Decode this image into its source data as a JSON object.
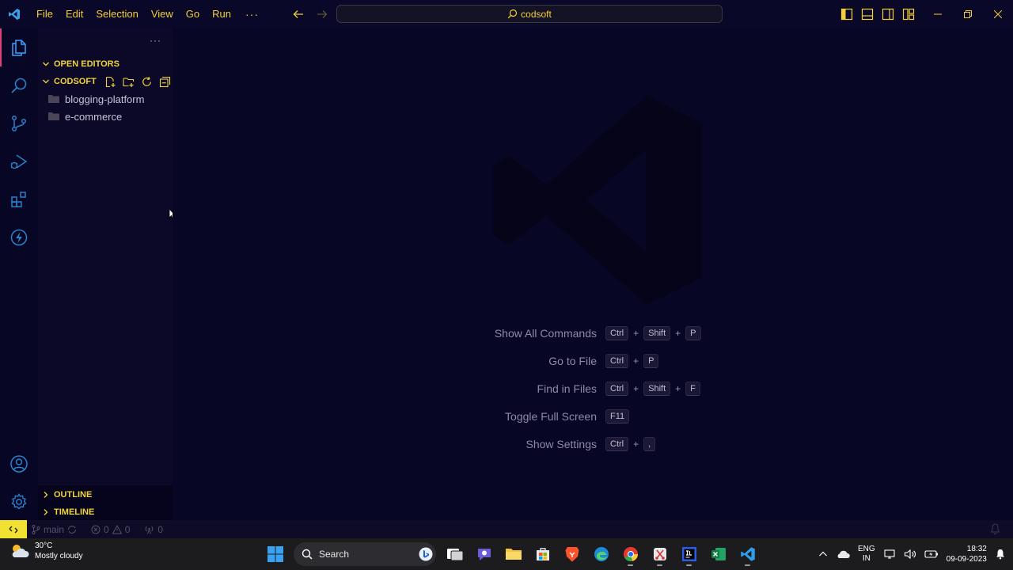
{
  "window": {
    "menu": [
      "File",
      "Edit",
      "Selection",
      "View",
      "Go",
      "Run"
    ],
    "menu_more": "···",
    "command_center_text": "codsoft"
  },
  "sidebar": {
    "more": "···",
    "open_editors_label": "OPEN EDITORS",
    "folder_label": "CODSOFT",
    "items": [
      {
        "label": "blogging-platform"
      },
      {
        "label": "e-commerce"
      }
    ],
    "outline_label": "OUTLINE",
    "timeline_label": "TIMELINE"
  },
  "editor": {
    "shortcuts": [
      {
        "label": "Show All Commands",
        "keys": [
          "Ctrl",
          "Shift",
          "P"
        ]
      },
      {
        "label": "Go to File",
        "keys": [
          "Ctrl",
          "P"
        ]
      },
      {
        "label": "Find in Files",
        "keys": [
          "Ctrl",
          "Shift",
          "F"
        ]
      },
      {
        "label": "Toggle Full Screen",
        "keys": [
          "F11"
        ]
      },
      {
        "label": "Show Settings",
        "keys": [
          "Ctrl",
          ","
        ]
      }
    ]
  },
  "statusbar": {
    "branch": "main",
    "errors": "0",
    "warnings": "0",
    "ports": "0"
  },
  "taskbar": {
    "temperature": "30°C",
    "weather": "Mostly cloudy",
    "search_label": "Search",
    "lang_top": "ENG",
    "lang_bottom": "IN",
    "time": "18:32",
    "date": "09-09-2023"
  },
  "colors": {
    "accent_yellow": "#f5d033",
    "active_indicator": "#e0407a",
    "background": "#070625"
  }
}
